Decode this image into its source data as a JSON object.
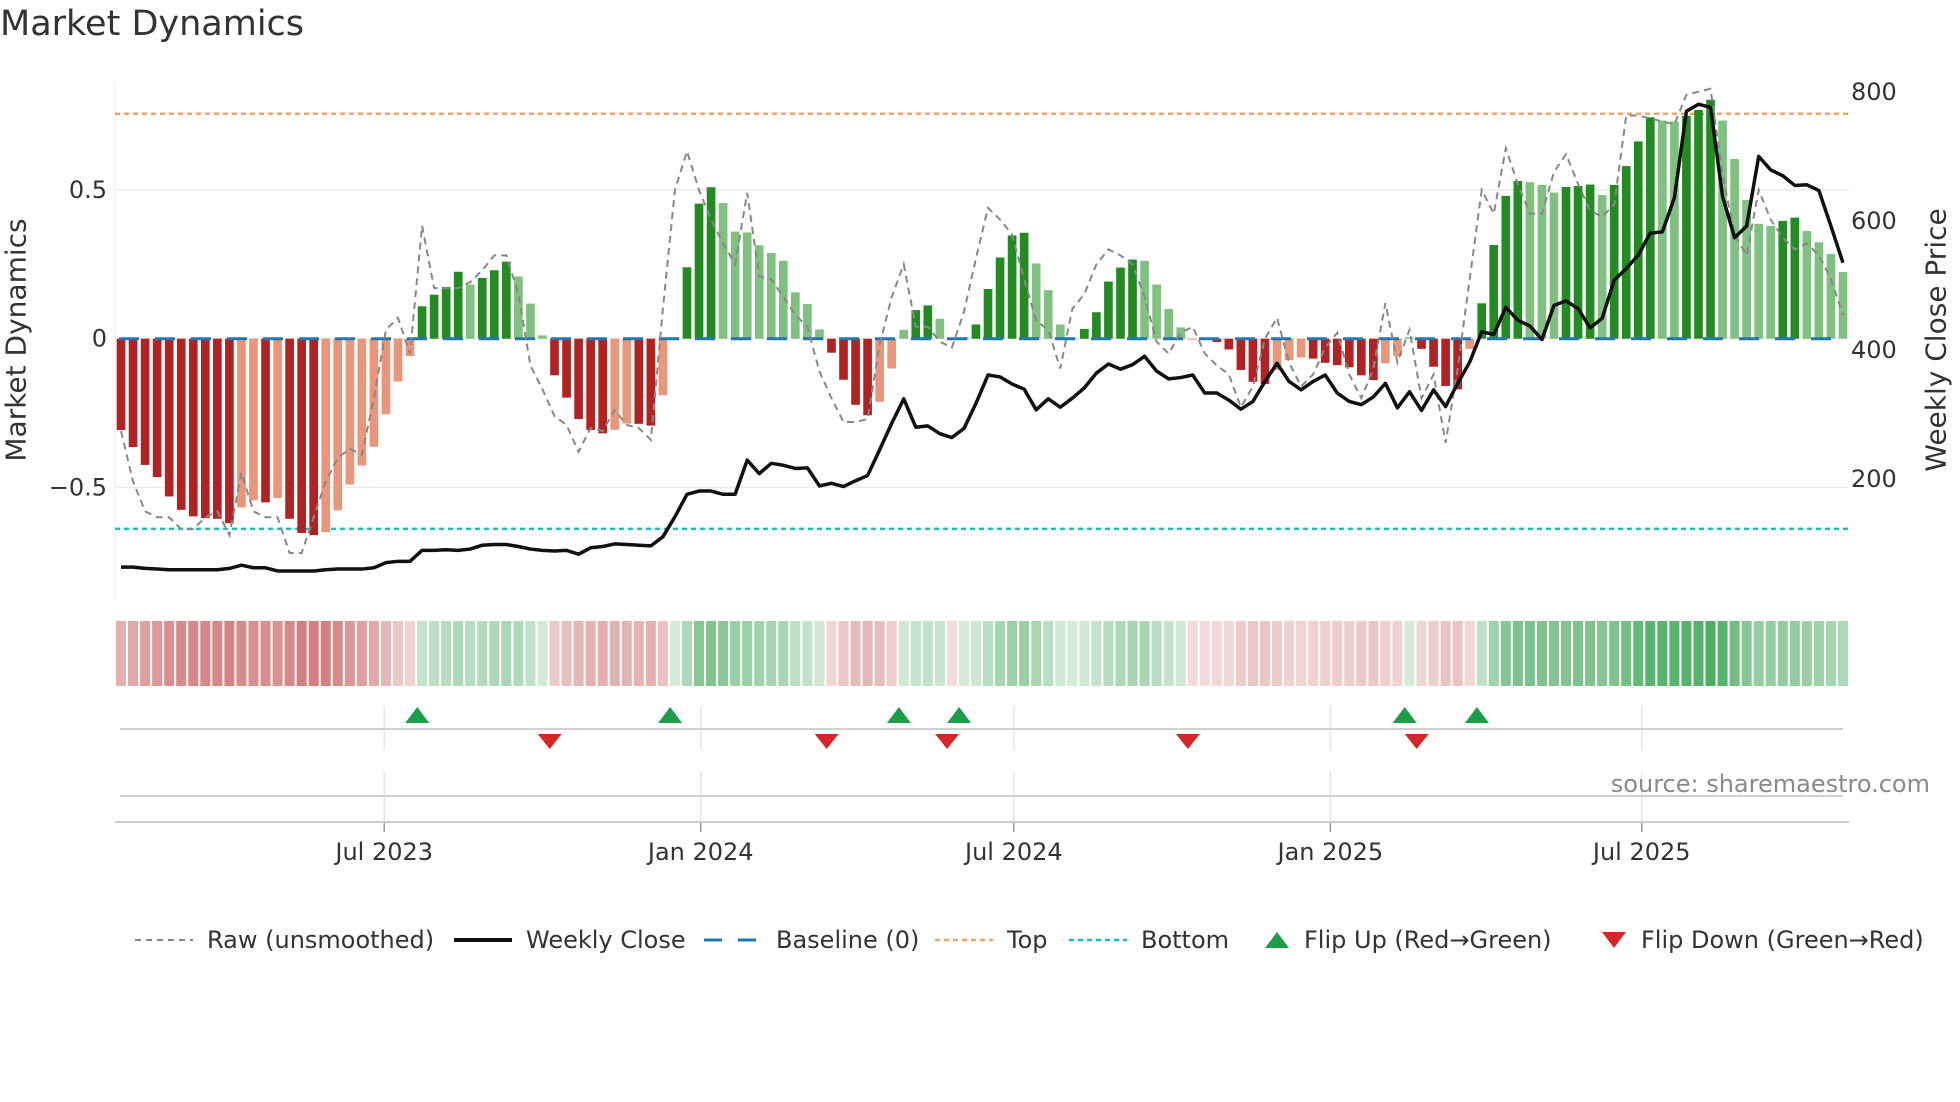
{
  "title": "Market Dynamics",
  "left_axis_label": "Market Dynamics",
  "right_axis_label": "Weekly Close Price",
  "source": "source: sharemaestro.com",
  "legend": {
    "raw": "Raw (unsmoothed)",
    "close": "Weekly Close",
    "baseline": "Baseline (0)",
    "top": "Top",
    "bottom": "Bottom",
    "flip_up": "Flip Up (Red→Green)",
    "flip_down": "Flip Down (Green→Red)"
  },
  "colors": {
    "bar_neg_strong": "#b22222",
    "bar_neg_weak": "#e9967a",
    "bar_pos_strong": "#228b22",
    "bar_pos_weak": "#80c080",
    "raw": "#888888",
    "close": "#111111",
    "baseline": "#1f77b4",
    "top": "#f4a460",
    "bottom": "#17becf",
    "flip_up": "#1a9e4a",
    "flip_down": "#d62728"
  },
  "chart_data": {
    "type": "bar",
    "title": "Market Dynamics",
    "xlabel": "",
    "ylabel": "Market Dynamics",
    "ylabel_right": "Weekly Close Price",
    "start_date": "2023-01-29",
    "frequency": "weekly",
    "ylim": [
      -0.878,
      0.866
    ],
    "ylim_right": [
      12,
      817
    ],
    "y_ticks": [
      {
        "value": 0.5,
        "label": "0.5"
      },
      {
        "value": 0,
        "label": "0"
      },
      {
        "value": -0.5,
        "label": "−0.5"
      }
    ],
    "y_ticks_right": [
      {
        "value": 200,
        "label": "200"
      },
      {
        "value": 400,
        "label": "400"
      },
      {
        "value": 600,
        "label": "600"
      },
      {
        "value": 800,
        "label": "800"
      }
    ],
    "x_ticks": [
      {
        "date": "2023-07-01",
        "label": "Jul 2023"
      },
      {
        "date": "2024-01-01",
        "label": "Jan 2024"
      },
      {
        "date": "2024-07-01",
        "label": "Jul 2024"
      },
      {
        "date": "2025-01-01",
        "label": "Jan 2025"
      },
      {
        "date": "2025-07-01",
        "label": "Jul 2025"
      }
    ],
    "top_level": 0.756,
    "bottom_level": -0.639,
    "baseline": 0,
    "grid": true,
    "legend_position": "bottom",
    "series": [
      {
        "name": "Market Dynamics (smoothed)",
        "values": [
          -0.307,
          -0.364,
          -0.424,
          -0.465,
          -0.53,
          -0.575,
          -0.597,
          -0.603,
          -0.605,
          -0.62,
          -0.567,
          -0.543,
          -0.55,
          -0.535,
          -0.605,
          -0.653,
          -0.66,
          -0.65,
          -0.577,
          -0.49,
          -0.426,
          -0.363,
          -0.254,
          -0.144,
          -0.058,
          0.109,
          0.148,
          0.174,
          0.225,
          0.182,
          0.204,
          0.23,
          0.259,
          0.209,
          0.118,
          0.011,
          -0.123,
          -0.198,
          -0.27,
          -0.307,
          -0.318,
          -0.306,
          -0.285,
          -0.286,
          -0.292,
          -0.19,
          0.005,
          0.24,
          0.454,
          0.509,
          0.456,
          0.36,
          0.357,
          0.314,
          0.288,
          0.262,
          0.156,
          0.117,
          0.031,
          -0.047,
          -0.138,
          -0.222,
          -0.257,
          -0.212,
          -0.1,
          0.03,
          0.096,
          0.112,
          0.067,
          -0.004,
          0.004,
          0.048,
          0.167,
          0.273,
          0.347,
          0.356,
          0.253,
          0.163,
          0.048,
          0.003,
          0.033,
          0.089,
          0.192,
          0.239,
          0.266,
          0.262,
          0.182,
          0.1,
          0.038,
          -0.003,
          -0.004,
          -0.011,
          -0.036,
          -0.105,
          -0.145,
          -0.152,
          -0.105,
          -0.072,
          -0.063,
          -0.067,
          -0.081,
          -0.089,
          -0.096,
          -0.123,
          -0.139,
          -0.083,
          -0.058,
          0.005,
          -0.034,
          -0.094,
          -0.159,
          -0.17,
          -0.034,
          0.119,
          0.315,
          0.48,
          0.53,
          0.526,
          0.517,
          0.491,
          0.51,
          0.513,
          0.518,
          0.483,
          0.517,
          0.58,
          0.663,
          0.744,
          0.733,
          0.73,
          0.749,
          0.769,
          0.803,
          0.733,
          0.604,
          0.466,
          0.386,
          0.379,
          0.396,
          0.407,
          0.362,
          0.324,
          0.285,
          0.224
        ]
      },
      {
        "name": "Raw (unsmoothed)",
        "values": [
          -0.31,
          -0.48,
          -0.58,
          -0.6,
          -0.6,
          -0.64,
          -0.64,
          -0.6,
          -0.58,
          -0.66,
          -0.45,
          -0.58,
          -0.6,
          -0.6,
          -0.72,
          -0.72,
          -0.6,
          -0.48,
          -0.4,
          -0.37,
          -0.39,
          -0.2,
          0.03,
          0.07,
          -0.05,
          0.38,
          0.17,
          0.17,
          0.17,
          0.19,
          0.23,
          0.28,
          0.28,
          0.15,
          -0.09,
          -0.17,
          -0.26,
          -0.29,
          -0.38,
          -0.3,
          -0.31,
          -0.24,
          -0.29,
          -0.3,
          -0.34,
          0.1,
          0.5,
          0.63,
          0.5,
          0.4,
          0.32,
          0.25,
          0.49,
          0.21,
          0.2,
          0.14,
          0.08,
          0.04,
          -0.11,
          -0.2,
          -0.28,
          -0.28,
          -0.27,
          -0.02,
          0.14,
          0.25,
          0.04,
          0.04,
          -0.01,
          -0.03,
          0.09,
          0.27,
          0.44,
          0.4,
          0.35,
          0.2,
          0.06,
          0.03,
          -0.1,
          0.1,
          0.15,
          0.25,
          0.3,
          0.28,
          0.25,
          0.14,
          -0.01,
          -0.05,
          0.02,
          0.04,
          -0.05,
          -0.09,
          -0.12,
          -0.23,
          -0.16,
          0.0,
          0.07,
          -0.08,
          -0.16,
          -0.12,
          -0.03,
          0.02,
          -0.12,
          -0.2,
          -0.1,
          0.12,
          -0.08,
          0.03,
          -0.2,
          -0.12,
          -0.35,
          -0.1,
          0.2,
          0.5,
          0.42,
          0.64,
          0.52,
          0.42,
          0.42,
          0.56,
          0.62,
          0.52,
          0.43,
          0.41,
          0.45,
          0.75,
          0.75,
          0.74,
          0.73,
          0.72,
          0.82,
          0.83,
          0.84,
          0.55,
          0.35,
          0.28,
          0.5,
          0.4,
          0.34,
          0.3,
          0.32,
          0.28,
          0.2,
          0.08
        ]
      },
      {
        "name": "Weekly Close",
        "axis": "right",
        "values": [
          63,
          63,
          61,
          60,
          59,
          59,
          59,
          59,
          59,
          61,
          66,
          62,
          62,
          57,
          57,
          57,
          57,
          59,
          60,
          60,
          60,
          62,
          70,
          72,
          72,
          89,
          89,
          90,
          89,
          91,
          97,
          98,
          98,
          95,
          91,
          89,
          88,
          89,
          83,
          93,
          95,
          99,
          98,
          97,
          96,
          110,
          141,
          176,
          181,
          181,
          176,
          176,
          229,
          208,
          224,
          221,
          216,
          217,
          189,
          193,
          188,
          197,
          205,
          245,
          286,
          324,
          280,
          282,
          270,
          264,
          278,
          317,
          361,
          358,
          347,
          339,
          307,
          324,
          311,
          325,
          341,
          364,
          378,
          370,
          377,
          390,
          367,
          355,
          357,
          361,
          333,
          333,
          322,
          308,
          320,
          351,
          379,
          351,
          338,
          351,
          361,
          333,
          320,
          315,
          327,
          348,
          310,
          335,
          306,
          338,
          312,
          348,
          381,
          428,
          424,
          466,
          446,
          437,
          416,
          469,
          476,
          464,
          434,
          449,
          508,
          526,
          547,
          581,
          583,
          636,
          770,
          781,
          776,
          638,
          574,
          592,
          700,
          679,
          670,
          655,
          656,
          647,
          592,
          535
        ]
      }
    ],
    "flip_up_weeks": [
      25,
      46,
      65,
      70,
      107,
      113
    ],
    "flip_down_weeks": [
      36,
      59,
      69,
      89,
      108
    ]
  }
}
